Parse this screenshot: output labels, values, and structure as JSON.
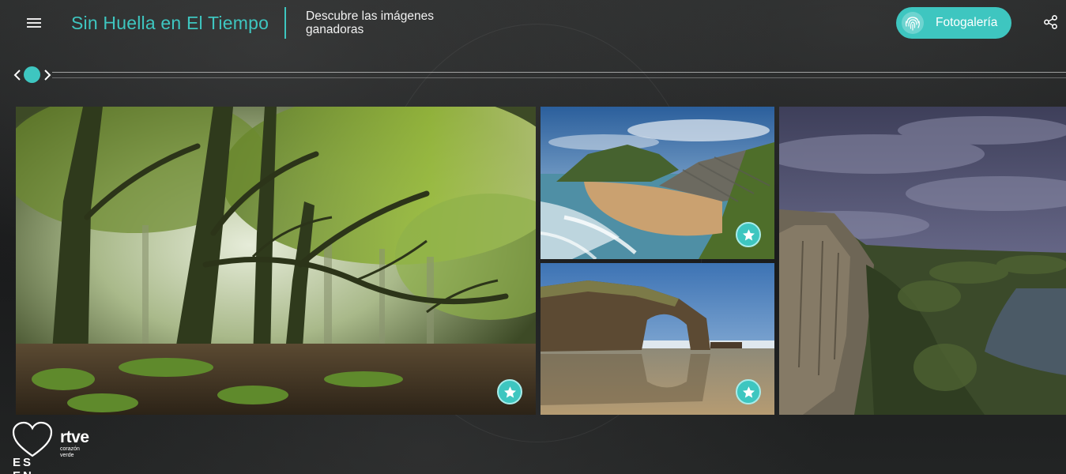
{
  "header": {
    "menu_icon": "hamburger-menu-icon",
    "title": "Sin Huella en El Tiempo",
    "subtitle": "Descubre las imágenes ganadoras",
    "gallery_button": {
      "label": "Fotogalería",
      "icon": "fingerprint-icon"
    },
    "share_icon": "share-icon"
  },
  "timeline": {
    "prev_icon": "chevron-left-icon",
    "next_icon": "chevron-right-icon"
  },
  "photos": [
    {
      "id": "forest",
      "subject": "misty beech forest",
      "badge_icon": "star-icon"
    },
    {
      "id": "cliffs-beach",
      "subject": "coastal cliffs and beach",
      "badge_icon": "star-icon"
    },
    {
      "id": "rock-arch",
      "subject": "rock arch on beach",
      "badge_icon": "star-icon"
    },
    {
      "id": "canyon",
      "subject": "river canyon under cloudy sky"
    }
  ],
  "footer": {
    "logo_es_text": "ES EN",
    "rtve_word": "rtve",
    "rtve_tagline_1": "corazón",
    "rtve_tagline_2": "verde"
  },
  "colors": {
    "accent": "#3ec6c0",
    "background": "#1b1d1e",
    "text": "#ffffff"
  }
}
